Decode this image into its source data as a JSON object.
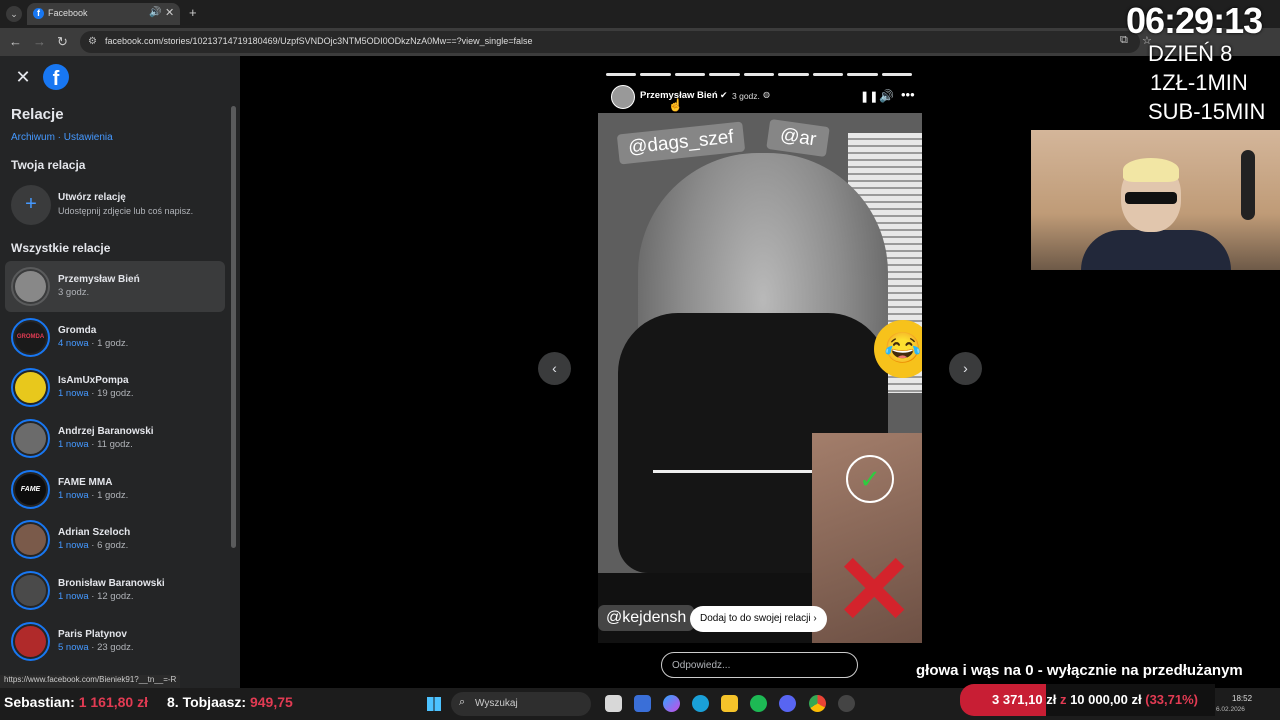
{
  "browser": {
    "tab_title": "Facebook",
    "url": "facebook.com/stories/10213714719180469/UzpfSVNDOjc3NTM5ODI0ODkzNzA0Mw==?view_single=false"
  },
  "sidebar": {
    "title": "Relacje",
    "archive_link": "Archiwum",
    "separator": " · ",
    "settings_link": "Ustawienia",
    "your_story_header": "Twoja relacja",
    "create_title": "Utwórz relację",
    "create_subtitle": "Udostępnij zdjęcie lub coś napisz.",
    "all_stories_header": "Wszystkie relacje",
    "stories": [
      {
        "name": "Przemysław Bień",
        "new": "",
        "time": "3 godz.",
        "color": "#888888",
        "avatar_text": ""
      },
      {
        "name": "Gromda",
        "new": "4 nowa",
        "time": " · 1 godz.",
        "color": "#1a1a1a",
        "avatar_text": "GROMDA"
      },
      {
        "name": "IsAmUxPompa",
        "new": "1 nowa",
        "time": " · 19 godz.",
        "color": "#e8c81c",
        "avatar_text": ""
      },
      {
        "name": "Andrzej Baranowski",
        "new": "1 nowa",
        "time": " · 11 godz.",
        "color": "#6b6b6b",
        "avatar_text": ""
      },
      {
        "name": "FAME MMA",
        "new": "1 nowa",
        "time": " · 1 godz.",
        "color": "#0d0d0d",
        "avatar_text": "FAME"
      },
      {
        "name": "Adrian Szeloch",
        "new": "1 nowa",
        "time": " · 6 godz.",
        "color": "#7a5a4a",
        "avatar_text": ""
      },
      {
        "name": "Bronisław Baranowski",
        "new": "1 nowa",
        "time": " · 12 godz.",
        "color": "#4a4a4a",
        "avatar_text": ""
      },
      {
        "name": "Paris Platynov",
        "new": "5 nowa",
        "time": " · 23 godz.",
        "color": "#b02a2a",
        "avatar_text": ""
      }
    ],
    "status_url": "https://www.facebook.com/Bieniek91?__tn__=-R"
  },
  "story": {
    "author": "Przemysław Bień",
    "time": "3 godz.",
    "progress_segments": 9,
    "sticker_1": "@dags_szef",
    "sticker_2": "@ar",
    "sticker_3": "@kejdensh",
    "add_to_story": "Dodaj to do swojej relacji",
    "reply_placeholder": "Odpowiedz..."
  },
  "overlay": {
    "clock": "06:29:13",
    "day": "DZIEŃ 8",
    "rate_1": "1ZŁ-1MIN",
    "rate_2": "SUB-15MIN",
    "caption": "głowa i wąs na 0 - wyłącznie na przedłużanym",
    "donation_current": "3 371,10 zł",
    "donation_sep": " z ",
    "donation_goal": "10 000,00 zł",
    "donation_pct": "(33,71%)",
    "donation_fraction": 0.3371
  },
  "taskbar": {
    "ticker_1_label": "Sebastian:",
    "ticker_1_amount": "1 161,80 zł",
    "ticker_2_label": "8. Tobjaasz:",
    "ticker_2_amount": "949,75",
    "search": "Wyszukaj",
    "time": "18:52",
    "date": "6.02.2026"
  },
  "colors": {
    "fb_blue": "#1877f2",
    "link_blue": "#4599ff",
    "sidebar_bg": "#242526",
    "accent_red": "#e23b53"
  }
}
